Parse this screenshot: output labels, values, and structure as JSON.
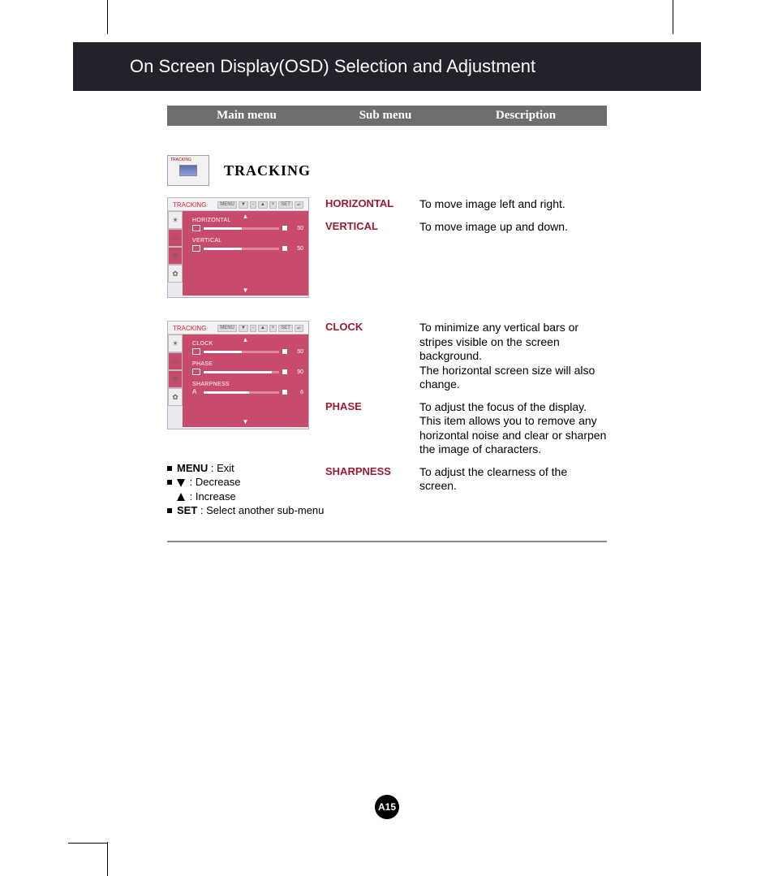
{
  "header": {
    "title": "On Screen Display(OSD) Selection and Adjustment"
  },
  "tableHeader": {
    "main": "Main menu",
    "sub": "Sub menu",
    "desc": "Description"
  },
  "section": {
    "thumbLabel": "TRACKING",
    "title": "TRACKING"
  },
  "osd1": {
    "title": "TRACKING",
    "nav": {
      "menu": "MENU",
      "set": "SET"
    },
    "items": [
      {
        "label": "HORIZONTAL",
        "value": "50",
        "fill": 50
      },
      {
        "label": "VERTICAL",
        "value": "50",
        "fill": 50
      }
    ]
  },
  "osd2": {
    "title": "TRACKING",
    "nav": {
      "menu": "MENU",
      "set": "SET"
    },
    "items": [
      {
        "label": "CLOCK",
        "value": "50",
        "fill": 50
      },
      {
        "label": "PHASE",
        "value": "90",
        "fill": 90
      },
      {
        "label": "SHARPNESS",
        "value": "6",
        "fill": 60
      }
    ]
  },
  "desc": {
    "horizontal": {
      "sub": "HORIZONTAL",
      "txt": "To move image left and right."
    },
    "vertical": {
      "sub": "VERTICAL",
      "txt": "To move image up and down."
    },
    "clock": {
      "sub": "CLOCK",
      "txt": "To minimize any vertical bars or stripes visible on the screen background.\nThe horizontal screen size will also change."
    },
    "phase": {
      "sub": "PHASE",
      "txt": "To adjust the focus of the display. This item allows you to remove any horizontal noise and clear or sharpen the image of characters."
    },
    "sharpness": {
      "sub": "SHARPNESS",
      "txt": "To adjust the clearness of the screen."
    }
  },
  "legend": {
    "menu": {
      "key": "MENU",
      "txt": " : Exit"
    },
    "dec": {
      "txt": " : Decrease"
    },
    "inc": {
      "txt": " : Increase"
    },
    "set": {
      "key": "SET",
      "txt": " : Select another sub-menu"
    }
  },
  "pageNumber": "A15"
}
